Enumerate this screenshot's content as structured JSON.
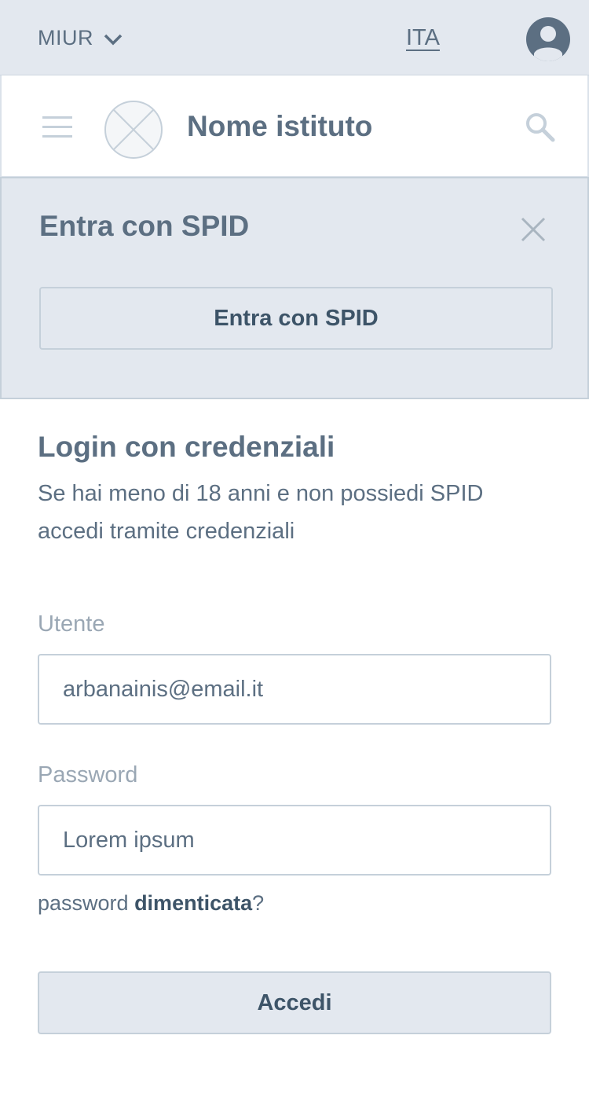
{
  "topbar": {
    "org_label": "MIUR",
    "lang_label": "ITA",
    "icons": {
      "dropdown": "chevron-down-icon",
      "user": "user-avatar-icon"
    }
  },
  "header": {
    "institute_name": "Nome istituto",
    "icons": {
      "menu": "hamburger-icon",
      "logo": "placeholder-logo-icon",
      "search": "search-icon"
    }
  },
  "spid": {
    "title": "Entra con SPID",
    "button_label": "Entra con SPID",
    "icons": {
      "close": "close-icon"
    }
  },
  "login": {
    "title": "Login con credenziali",
    "description": "Se hai meno di 18 anni e non possiedi SPID accedi tramite credenziali",
    "user_label": "Utente",
    "user_value": "arbanainis@email.it",
    "password_label": "Password",
    "password_value": "Lorem ipsum",
    "forgot_prefix": "password ",
    "forgot_bold": "dimenticata",
    "forgot_suffix": "?",
    "submit_label": "Accedi"
  },
  "colors": {
    "panel_bg": "#e3e8ef",
    "text": "#5c6f82",
    "text_dark": "#3d5468",
    "border": "#c5d0da"
  }
}
